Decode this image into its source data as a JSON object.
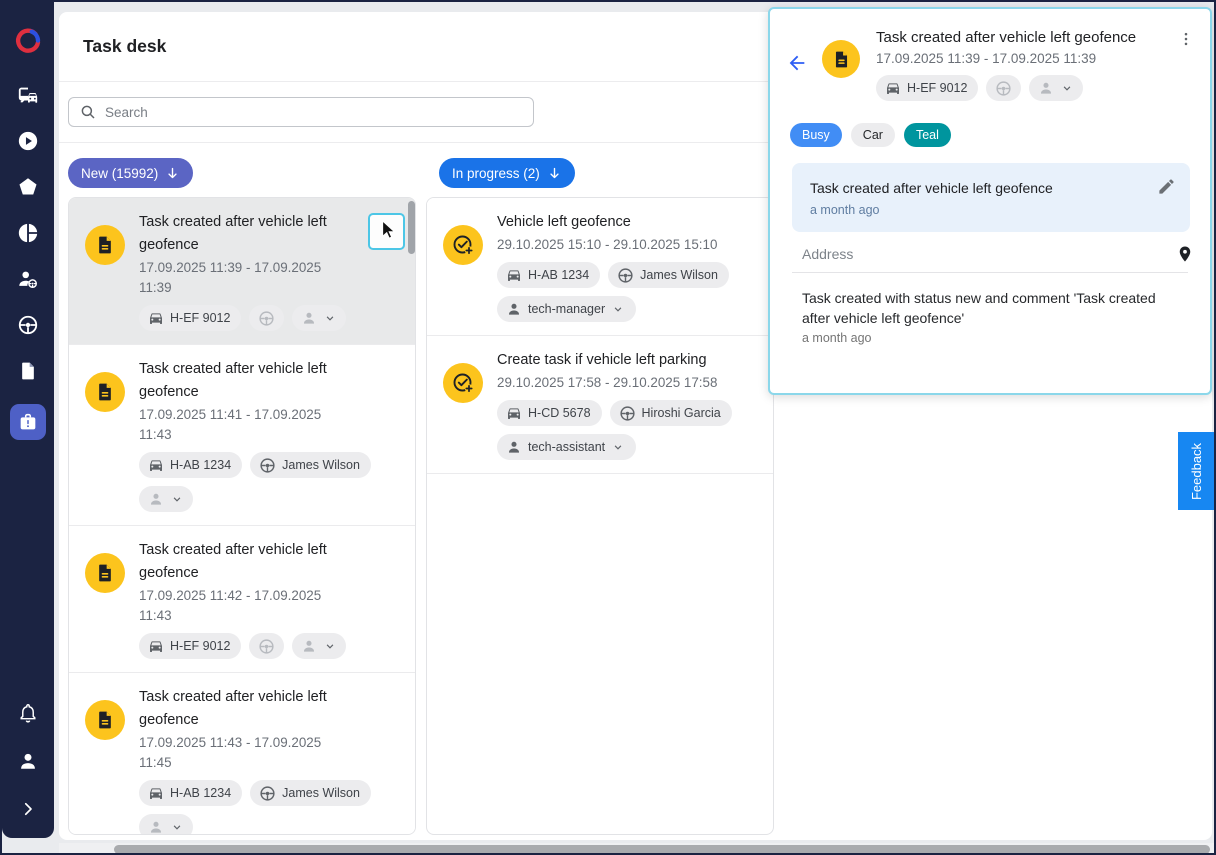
{
  "app": {
    "title": "Task desk",
    "search_placeholder": "Search"
  },
  "sidebar": {
    "active_item": "task-desk",
    "icons": [
      "logo",
      "vehicles",
      "playback",
      "geofences",
      "reports",
      "drivers",
      "driving",
      "documents",
      "task-desk",
      "notifications",
      "profile",
      "expand"
    ]
  },
  "board": {
    "columns": [
      {
        "label": "New (15992)",
        "count": 15992,
        "accent": "#5b65c4",
        "cards": [
          {
            "title": "Task created after vehicle left geofence",
            "date": "17.09.2025 11:39 - 17.09.2025 11:39",
            "vehicle": "H-EF 9012",
            "driver": "",
            "assignee": ""
          },
          {
            "title": "Task created after vehicle left geofence",
            "date": "17.09.2025 11:41 - 17.09.2025 11:43",
            "vehicle": "H-AB 1234",
            "driver": "James Wilson",
            "assignee": ""
          },
          {
            "title": "Task created after vehicle left geofence",
            "date": "17.09.2025 11:42 - 17.09.2025 11:43",
            "vehicle": "H-EF 9012",
            "driver": "",
            "assignee": ""
          },
          {
            "title": "Task created after vehicle left geofence",
            "date": "17.09.2025 11:43 - 17.09.2025 11:45",
            "vehicle": "H-AB 1234",
            "driver": "James Wilson",
            "assignee": ""
          }
        ]
      },
      {
        "label": "In progress (2)",
        "count": 2,
        "accent": "#1a73e8",
        "cards": [
          {
            "title": "Vehicle left geofence",
            "date": "29.10.2025 15:10 - 29.10.2025 15:10",
            "vehicle": "H-AB 1234",
            "driver": "James Wilson",
            "assignee": "tech-manager"
          },
          {
            "title": "Create task if vehicle left parking",
            "date": "29.10.2025 17:58 - 29.10.2025 17:58",
            "vehicle": "H-CD 5678",
            "driver": "Hiroshi Garcia",
            "assignee": "tech-assistant"
          }
        ]
      }
    ]
  },
  "panel": {
    "title": "Task created after vehicle left geofence",
    "date": "17.09.2025 11:39 - 17.09.2025 11:39",
    "vehicle": "H-EF 9012",
    "tags": [
      {
        "label": "Busy",
        "color": "#418df5"
      },
      {
        "label": "Car",
        "color": "#ececec"
      },
      {
        "label": "Teal",
        "color": "#00959e"
      }
    ],
    "comment": {
      "title": "Task created after vehicle left geofence",
      "time": "a month ago"
    },
    "address_label": "Address",
    "history": {
      "text": "Task created with status new and comment 'Task created after vehicle left geofence'",
      "time": "a month ago"
    }
  },
  "feedback": {
    "label": "Feedback"
  },
  "colors": {
    "sidebar_bg": "#1b2342",
    "sidebar_active": "#4e60c6",
    "avatar_yellow": "#fcc41d",
    "panel_border": "#8bd7ea",
    "feedback_blue": "#1787f2",
    "selected_card_bg": "#e8e9ea",
    "cursor_highlight": "#4cc6e6"
  }
}
